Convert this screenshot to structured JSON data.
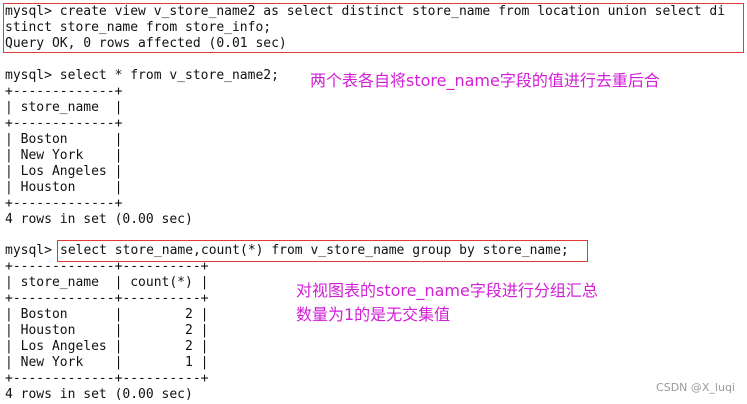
{
  "terminal": {
    "block1": {
      "lines": [
        "mysql> create view v_store_name2 as select distinct store_name from location union select di",
        "stinct store_name from store_info;",
        "Query OK, 0 rows affected (0.01 sec)"
      ]
    },
    "block2": {
      "prompt": "mysql> select * from v_store_name2;",
      "table_lines": [
        "+-------------+",
        "| store_name  |",
        "+-------------+",
        "| Boston      |",
        "| New York    |",
        "| Los Angeles |",
        "| Houston     |",
        "+-------------+"
      ],
      "status": "4 rows in set (0.00 sec)"
    },
    "block3": {
      "prompt_prefix": "mysql> ",
      "query": "select store_name,count(*) from v_store_name group by store_name;",
      "table_lines": [
        "+-------------+----------+",
        "| store_name  | count(*) |",
        "+-------------+----------+",
        "| Boston      |        2 |",
        "| Houston     |        2 |",
        "| Los Angeles |        2 |",
        "| New York    |        1 |",
        "+-------------+----------+"
      ],
      "status": "4 rows in set (0.00 sec)"
    }
  },
  "annotations": {
    "note1": "两个表各自将store_name字段的值进行去重后合",
    "note2_line1": "对视图表的store_name字段进行分组汇总",
    "note2_line2": "数量为1的是无交集值"
  },
  "watermark": "CSDN @X_luqi",
  "colors": {
    "annotation": "#d21ed6",
    "highlight_box": "#e03a3a",
    "terminal_text": "#111111"
  }
}
